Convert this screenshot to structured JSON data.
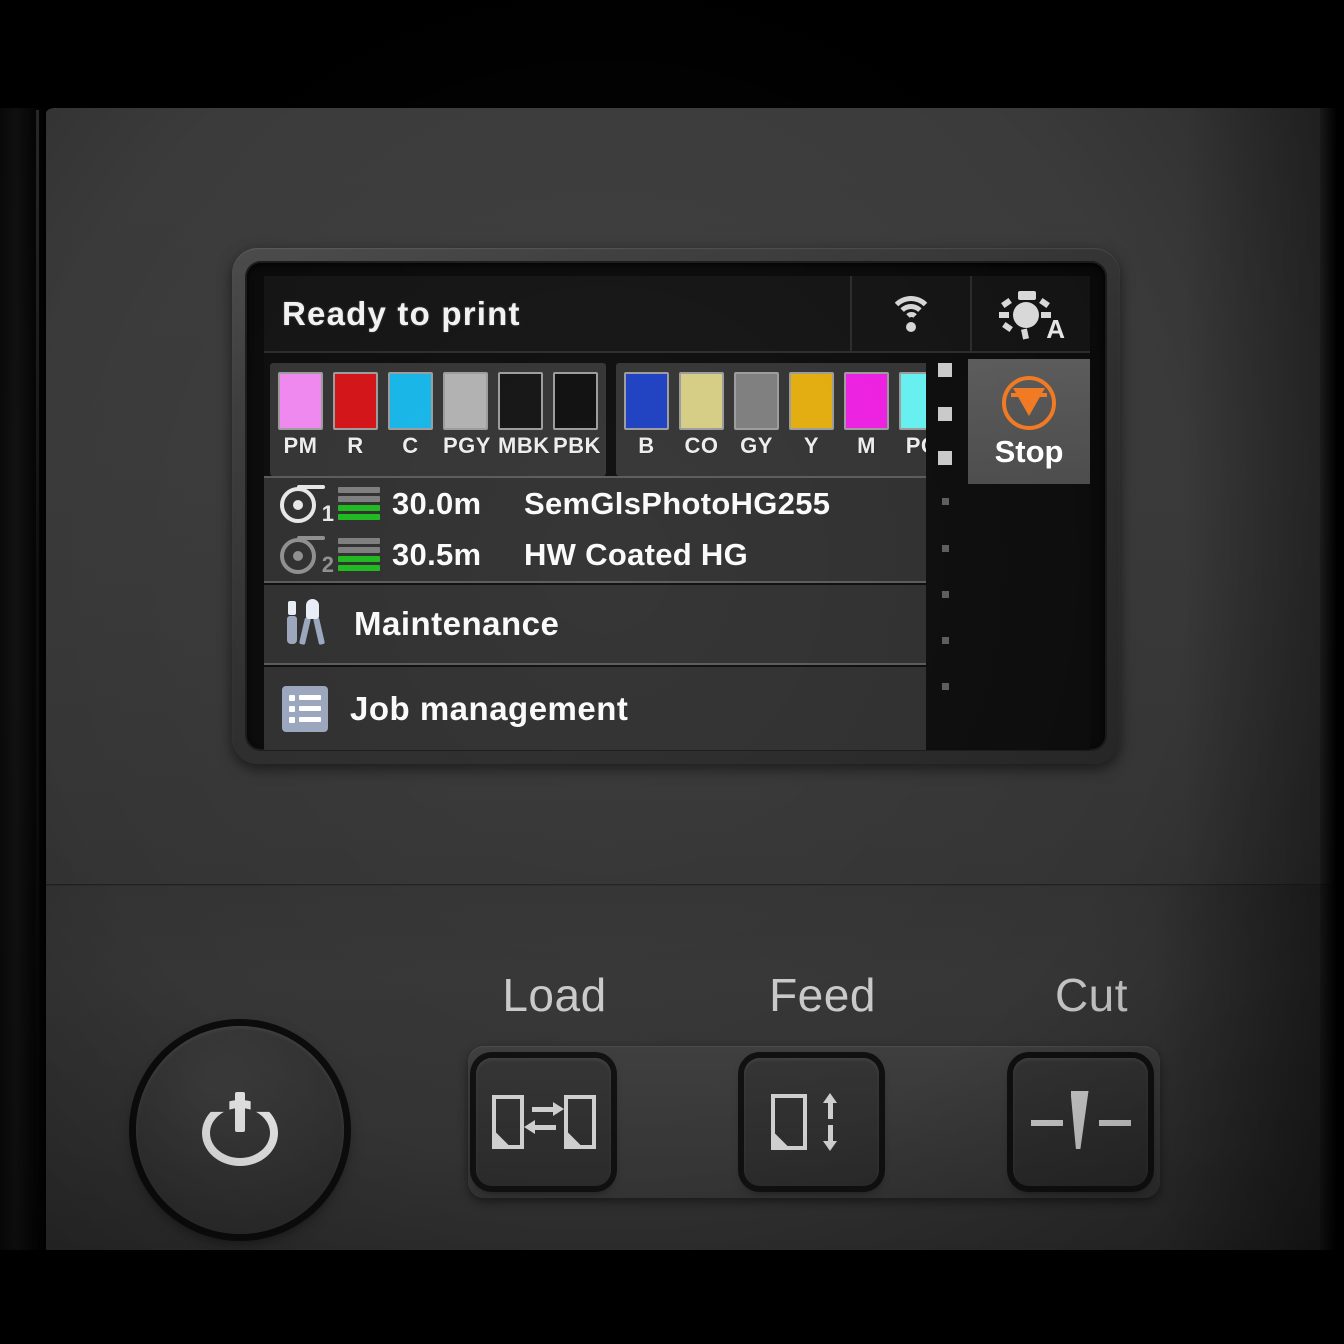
{
  "device": {
    "name": "large-format-printer-control-panel"
  },
  "lcd": {
    "status_bar": {
      "message": "Ready to print",
      "network_icon": "wifi-icon",
      "lamp_icon": "lamp-auto-icon",
      "lamp_auto_label": "A"
    },
    "ink": {
      "groups": [
        {
          "slots": [
            {
              "label": "PM",
              "color": "#ef87ef"
            },
            {
              "label": "R",
              "color": "#d21216"
            },
            {
              "label": "C",
              "color": "#15b5e8"
            },
            {
              "label": "PGY",
              "color": "#b0b0b0"
            },
            {
              "label": "MBK",
              "color": "#121212"
            },
            {
              "label": "PBK",
              "color": "#0d0d0d"
            }
          ]
        },
        {
          "slots": [
            {
              "label": "B",
              "color": "#1d3fc0"
            },
            {
              "label": "CO",
              "color": "#d5cd83"
            },
            {
              "label": "GY",
              "color": "#7d7d7d"
            },
            {
              "label": "Y",
              "color": "#e2ac0d"
            },
            {
              "label": "M",
              "color": "#ec1fe0"
            },
            {
              "label": "PC",
              "color": "#66eff0"
            }
          ]
        }
      ]
    },
    "media_rows": [
      {
        "icon": "roll-1-icon",
        "roll_number": "1",
        "length": "30.0m",
        "media_name": "SemGlsPhotoHG255",
        "gauge": [
          "empty",
          "empty",
          "full",
          "full"
        ],
        "active": true
      },
      {
        "icon": "roll-2-icon",
        "roll_number": "2",
        "length": "30.5m",
        "media_name": "HW Coated HG",
        "gauge": [
          "empty",
          "empty",
          "full",
          "full"
        ],
        "active": false
      }
    ],
    "menu_rows": [
      {
        "icon": "tools-icon",
        "label": "Maintenance"
      },
      {
        "icon": "list-icon",
        "label": "Job management"
      }
    ],
    "stop_button": {
      "label": "Stop",
      "icon": "stop-sign-icon",
      "accent_color": "#f07a22"
    },
    "scroll_indicator": {
      "total": 8,
      "active": 3
    }
  },
  "panel_buttons": [
    {
      "caption": "Load",
      "icon": "load-media-icon"
    },
    {
      "caption": "Feed",
      "icon": "feed-media-icon"
    },
    {
      "caption": "Cut",
      "icon": "cut-media-icon"
    }
  ],
  "power_button": {
    "icon": "power-icon"
  }
}
